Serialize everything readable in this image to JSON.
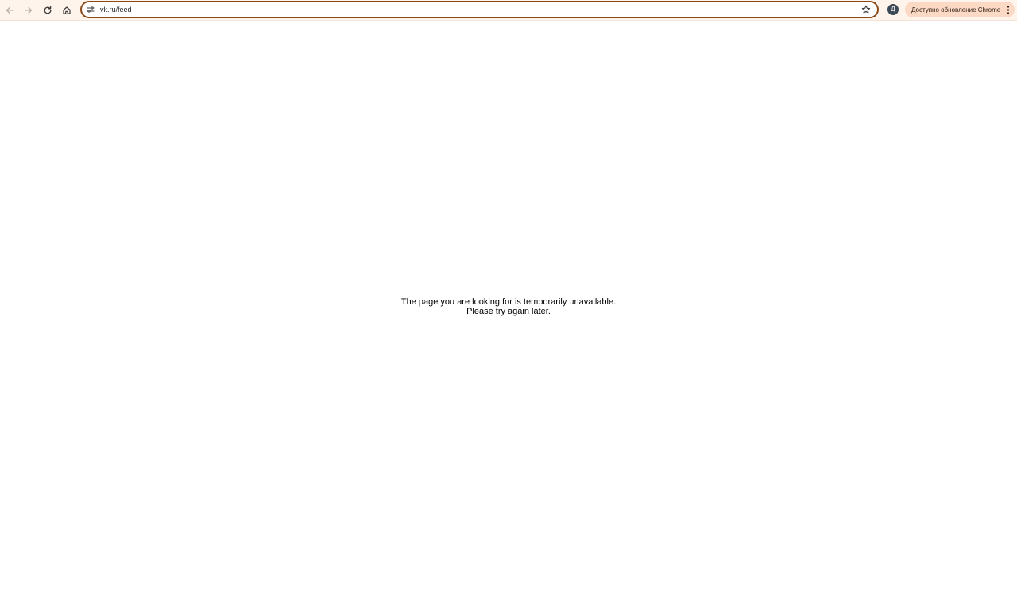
{
  "browser": {
    "address_bar": {
      "url": "vk.ru/feed"
    },
    "profile": {
      "initial": "Д"
    },
    "update_button": {
      "label": "Доступно обновление Chrome"
    },
    "icons": {
      "back": "arrow-left-icon",
      "forward": "arrow-right-icon",
      "reload": "reload-icon",
      "home": "home-icon",
      "site_info": "tune-icon",
      "bookmark": "star-icon",
      "menu": "kebab-menu-icon"
    },
    "colors": {
      "toolbar_bg": "#fff4ec",
      "omnibox_border": "#8a4b1a",
      "update_chip_bg": "#fbd9c4",
      "avatar_bg": "#3d4a56"
    }
  },
  "page": {
    "message_line1": "The page you are looking for is temporarily unavailable.",
    "message_line2": "Please try again later."
  }
}
